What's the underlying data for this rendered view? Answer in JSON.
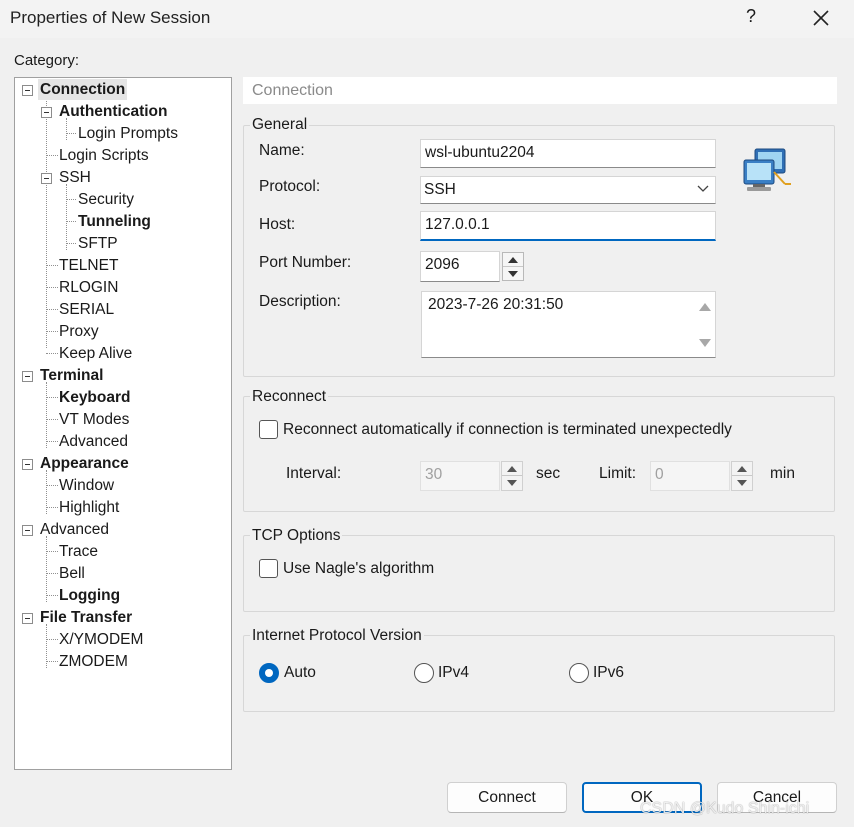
{
  "window": {
    "title": "Properties of New Session",
    "help": "?"
  },
  "category_label": "Category:",
  "tree": [
    {
      "label": "Connection",
      "bold": true,
      "selected": true
    },
    {
      "label": "Authentication",
      "bold": true
    },
    {
      "label": "Login Prompts",
      "bold": false
    },
    {
      "label": "Login Scripts",
      "bold": false
    },
    {
      "label": "SSH",
      "bold": false
    },
    {
      "label": "Security",
      "bold": false
    },
    {
      "label": "Tunneling",
      "bold": true
    },
    {
      "label": "SFTP",
      "bold": false
    },
    {
      "label": "TELNET",
      "bold": false
    },
    {
      "label": "RLOGIN",
      "bold": false
    },
    {
      "label": "SERIAL",
      "bold": false
    },
    {
      "label": "Proxy",
      "bold": false
    },
    {
      "label": "Keep Alive",
      "bold": false
    },
    {
      "label": "Terminal",
      "bold": true
    },
    {
      "label": "Keyboard",
      "bold": true
    },
    {
      "label": "VT Modes",
      "bold": false
    },
    {
      "label": "Advanced",
      "bold": false
    },
    {
      "label": "Appearance",
      "bold": true
    },
    {
      "label": "Window",
      "bold": false
    },
    {
      "label": "Highlight",
      "bold": false
    },
    {
      "label": "Advanced",
      "bold": false
    },
    {
      "label": "Trace",
      "bold": false
    },
    {
      "label": "Bell",
      "bold": false
    },
    {
      "label": "Logging",
      "bold": true
    },
    {
      "label": "File Transfer",
      "bold": true
    },
    {
      "label": "X/YMODEM",
      "bold": false
    },
    {
      "label": "ZMODEM",
      "bold": false
    }
  ],
  "panel_title": "Connection",
  "general": {
    "legend": "General",
    "name_label": "Name:",
    "name_value": "wsl-ubuntu2204",
    "protocol_label": "Protocol:",
    "protocol_value": "SSH",
    "host_label": "Host:",
    "host_value": "127.0.0.1",
    "port_label": "Port Number:",
    "port_value": "2096",
    "description_label": "Description:",
    "description_value": "2023-7-26 20:31:50"
  },
  "reconnect": {
    "legend": "Reconnect",
    "checkbox_label": "Reconnect automatically if connection is terminated unexpectedly",
    "checked": false,
    "interval_label": "Interval:",
    "interval_value": "30",
    "interval_unit": "sec",
    "limit_label": "Limit:",
    "limit_value": "0",
    "limit_unit": "min"
  },
  "tcp": {
    "legend": "TCP Options",
    "nagle_label": "Use Nagle's algorithm",
    "checked": false
  },
  "ip_version": {
    "legend": "Internet Protocol Version",
    "options": [
      "Auto",
      "IPv4",
      "IPv6"
    ],
    "selected": "Auto"
  },
  "buttons": {
    "connect": "Connect",
    "ok": "OK",
    "cancel": "Cancel"
  },
  "watermark": "CSDN @Kudo Shin-ichi",
  "colors": {
    "accent": "#0067c0",
    "background": "#f0f0f0"
  }
}
